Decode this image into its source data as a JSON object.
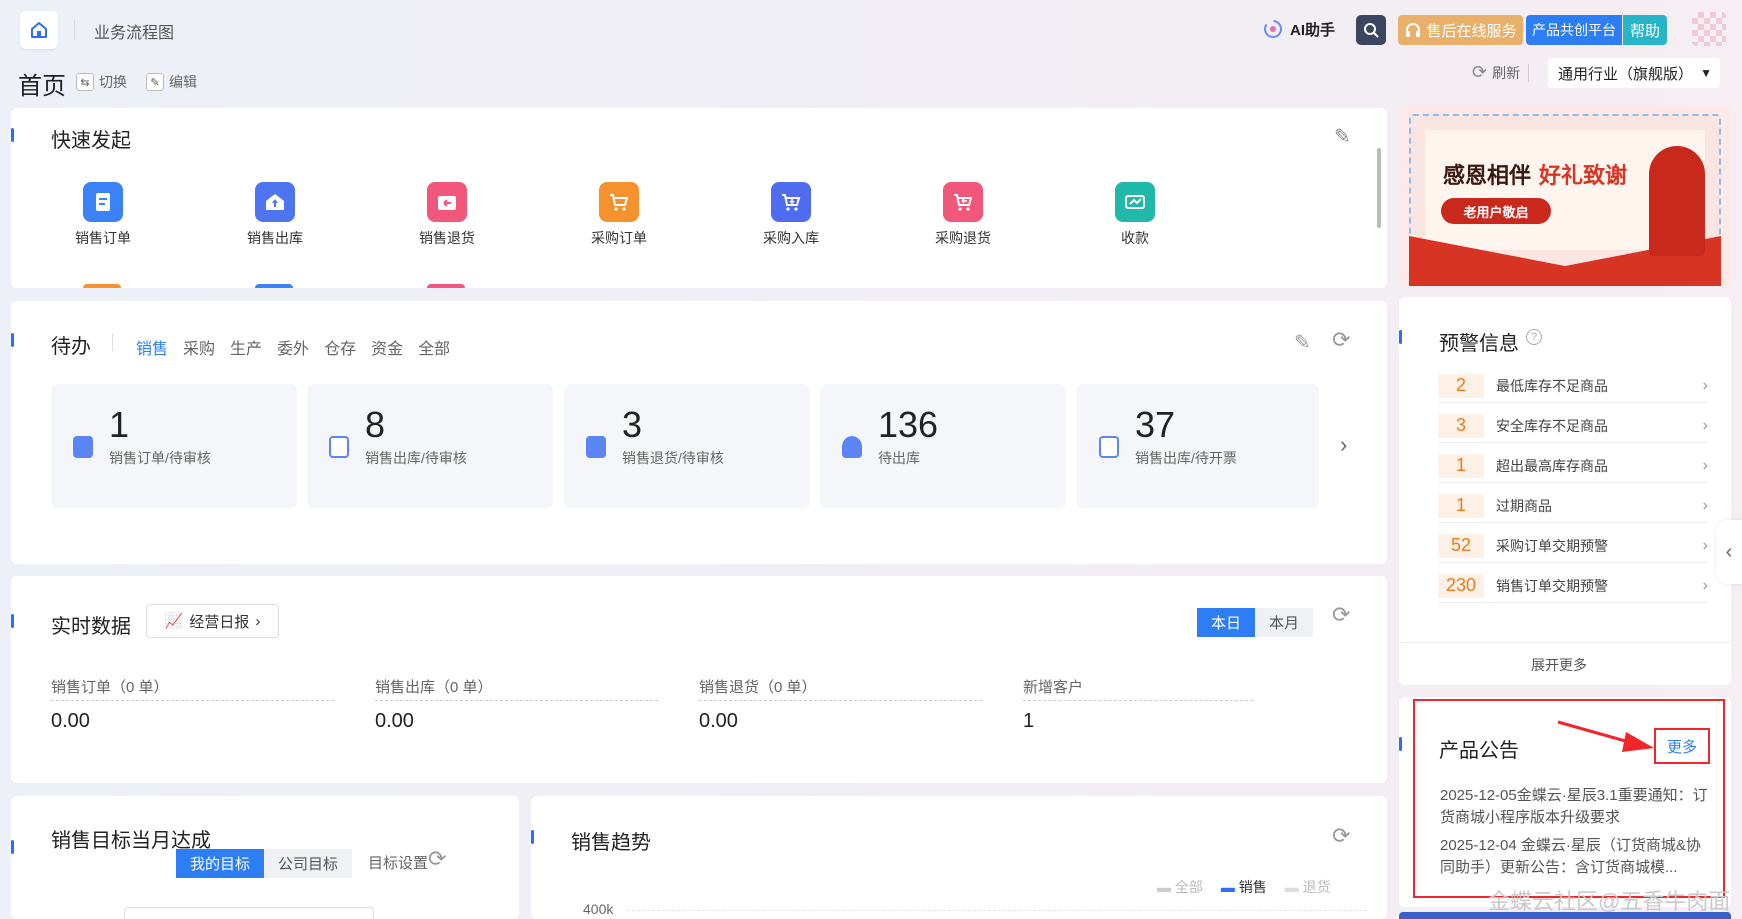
{
  "header": {
    "flow_chart": "业务流程图",
    "ai_helper": "AI助手",
    "service": "售后在线服务",
    "platform": "产品共创平台",
    "help": "帮助"
  },
  "page": {
    "title": "首页",
    "switch": "切换",
    "edit": "编辑",
    "refresh": "刷新",
    "industry": "通用行业（旗舰版）"
  },
  "quick": {
    "title": "快速发起",
    "items": [
      {
        "label": "销售订单",
        "color": "#3b82f6"
      },
      {
        "label": "销售出库",
        "color": "#4f74f0"
      },
      {
        "label": "销售退货",
        "color": "#f0577a"
      },
      {
        "label": "采购订单",
        "color": "#f5922e"
      },
      {
        "label": "采购入库",
        "color": "#4f6cf0"
      },
      {
        "label": "采购退货",
        "color": "#f0577a"
      },
      {
        "label": "收款",
        "color": "#20b8a8"
      }
    ]
  },
  "todo": {
    "title": "待办",
    "tabs": [
      "销售",
      "采购",
      "生产",
      "委外",
      "仓存",
      "资金",
      "全部"
    ],
    "items": [
      {
        "num": "1",
        "label": "销售订单/待审核",
        "color": "#4f7cf5"
      },
      {
        "num": "8",
        "label": "销售出库/待审核",
        "color": "#4f7cf5"
      },
      {
        "num": "3",
        "label": "销售退货/待审核",
        "color": "#4f7cf5"
      },
      {
        "num": "136",
        "label": "待出库",
        "color": "#4f7cf5"
      },
      {
        "num": "37",
        "label": "销售出库/待开票",
        "color": "#4f7cf5"
      }
    ]
  },
  "realtime": {
    "title": "实时数据",
    "report": "经营日报",
    "today": "本日",
    "month": "本月",
    "metrics": [
      {
        "label": "销售订单（0 单）",
        "value": "0.00"
      },
      {
        "label": "销售出库（0 单）",
        "value": "0.00"
      },
      {
        "label": "销售退货（0 单）",
        "value": "0.00"
      },
      {
        "label": "新增客户",
        "value": "1"
      }
    ]
  },
  "target": {
    "title": "销售目标当月达成",
    "mine": "我的目标",
    "company": "公司目标",
    "setting": "目标设置"
  },
  "trend": {
    "title": "销售趋势",
    "legend": [
      "全部",
      "销售",
      "退货"
    ],
    "ytick": "400k"
  },
  "banner": {
    "headline": "感恩相伴",
    "headline2": "好礼致谢",
    "button": "老用户敬启"
  },
  "warning": {
    "title": "预警信息",
    "items": [
      {
        "num": "2",
        "label": "最低库存不足商品"
      },
      {
        "num": "3",
        "label": "安全库存不足商品"
      },
      {
        "num": "1",
        "label": "超出最高库存商品"
      },
      {
        "num": "1",
        "label": "过期商品"
      },
      {
        "num": "52",
        "label": "采购订单交期预警"
      },
      {
        "num": "230",
        "label": "销售订单交期预警"
      }
    ],
    "expand": "展开更多"
  },
  "notice": {
    "title": "产品公告",
    "more": "更多",
    "items": [
      "2025-12-05金蝶云·星辰3.1重要通知：订货商城小程序版本升级要求",
      "2025-12-04 金蝶云·星辰（订货商城&协同助手）更新公告：含订货商城模..."
    ]
  },
  "watermark": "金蝶云社区@五香牛肉面"
}
